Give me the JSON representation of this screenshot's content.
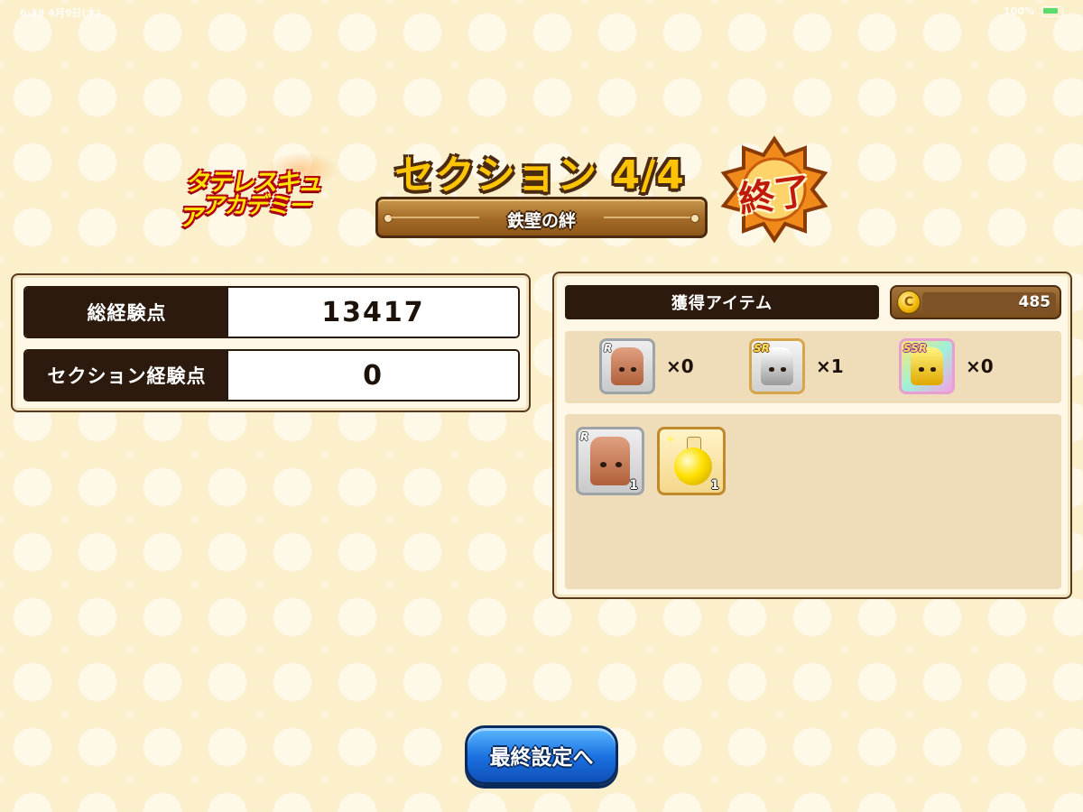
{
  "status_bar": {
    "time": "6:39 4月9日(木)",
    "battery": "100%"
  },
  "header": {
    "logo_line1": "タテレスキュア",
    "logo_line2": "アカデミー",
    "section_title": "セクション 4/4",
    "subtitle": "鉄壁の絆",
    "finish_badge": "終了"
  },
  "experience": {
    "total_label": "総経験点",
    "total_value": "13417",
    "section_label": "セクション経験点",
    "section_value": "0"
  },
  "items": {
    "header": "獲得アイテム",
    "coins": "485",
    "tiers": [
      {
        "rarity": "R",
        "count": "×0",
        "color": "bronze"
      },
      {
        "rarity": "SR",
        "count": "×1",
        "color": "silver"
      },
      {
        "rarity": "SSR",
        "count": "×0",
        "color": "gold"
      }
    ],
    "drops": [
      {
        "rarity": "R",
        "qty": "1",
        "icon": "bronze-character-icon"
      },
      {
        "qty": "1",
        "icon": "yellow-potion-icon"
      }
    ]
  },
  "footer": {
    "next_button": "最終設定へ"
  },
  "colors": {
    "background": "#fbefcc",
    "dark_label": "#2b1a0d",
    "button_blue": "#1a6fe0"
  }
}
